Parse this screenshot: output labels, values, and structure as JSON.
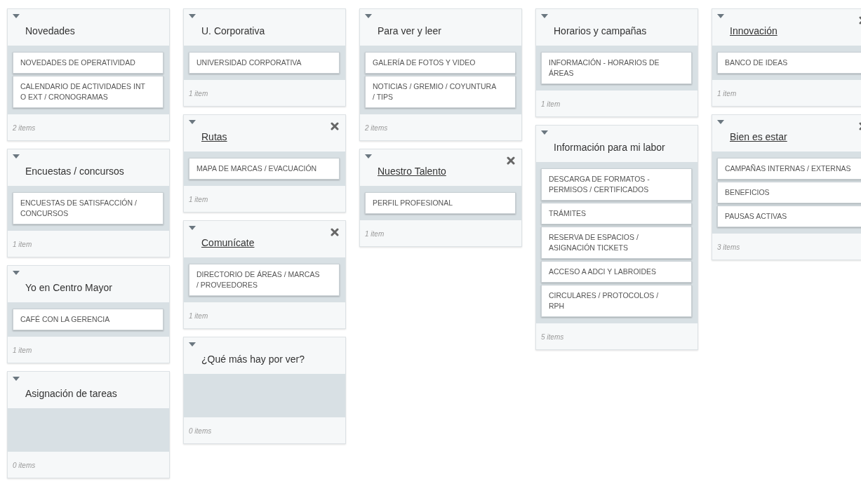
{
  "columns": [
    {
      "lists": [
        {
          "title": "Novedades",
          "linked": false,
          "removable": false,
          "cards": [
            "NOVEDADES DE OPERATIVIDAD",
            "CALENDARIO DE ACTIVIDADES INT O EXT / CRONOGRAMAS"
          ],
          "count": "2 items"
        },
        {
          "title": "Encuestas / concursos",
          "linked": false,
          "removable": false,
          "cards": [
            "ENCUESTAS DE SATISFACCIÓN / CONCURSOS"
          ],
          "count": "1 item"
        },
        {
          "title": "Yo en Centro Mayor",
          "linked": false,
          "removable": false,
          "cards": [
            "CAFÉ CON LA GERENCIA"
          ],
          "count": "1 item"
        },
        {
          "title": "Asignación de tareas",
          "linked": false,
          "removable": false,
          "count": "0 items"
        }
      ]
    },
    {
      "lists": [
        {
          "title": "U. Corporativa",
          "linked": false,
          "removable": false,
          "cards": [
            "UNIVERSIDAD CORPORATIVA"
          ],
          "count": "1 item"
        },
        {
          "title": "Rutas",
          "linked": true,
          "removable": true,
          "cards": [
            "MAPA DE MARCAS / EVACUACIÓN"
          ],
          "count": "1 item"
        },
        {
          "title": "Comunícate",
          "linked": true,
          "removable": true,
          "cards": [
            "DIRECTORIO DE ÁREAS / MARCAS / PROVEEDORES"
          ],
          "count": "1 item"
        },
        {
          "title": "¿Qué más hay por ver?",
          "linked": false,
          "removable": false,
          "count": "0 items"
        }
      ]
    },
    {
      "lists": [
        {
          "title": "Para ver y leer",
          "linked": false,
          "removable": false,
          "cards": [
            "GALERÍA DE FOTOS Y VIDEO",
            "NOTICIAS / GREMIO / COYUNTURA / TIPS"
          ],
          "count": "2 items"
        },
        {
          "title": "Nuestro Talento",
          "linked": true,
          "removable": true,
          "cards": [
            "PERFIL PROFESIONAL"
          ],
          "count": "1 item"
        }
      ]
    },
    {
      "lists": [
        {
          "title": "Horarios y campañas",
          "linked": false,
          "removable": false,
          "cards": [
            "INFORMACIÓN - HORARIOS DE ÁREAS"
          ],
          "count": "1 item"
        },
        {
          "title": "Información para mi labor",
          "linked": false,
          "removable": false,
          "cards": [
            "DESCARGA DE FORMATOS - PERMISOS / CERTIFICADOS",
            "TRÁMITES",
            "RESERVA DE ESPACIOS / ASIGNACIÓN TICKETS",
            "ACCESO A ADCI Y LABROIDES",
            "CIRCULARES / PROTOCOLOS / RPH"
          ],
          "count": "5 items"
        }
      ]
    },
    {
      "lists": [
        {
          "title": "Innovación",
          "linked": true,
          "removable": true,
          "cards": [
            "BANCO DE IDEAS"
          ],
          "count": "1 item"
        },
        {
          "title": "Bien es estar",
          "linked": true,
          "removable": true,
          "cards": [
            "CAMPAÑAS INTERNAS / EXTERNAS",
            "BENEFICIOS",
            "PAUSAS ACTIVAS"
          ],
          "count": "3 items"
        }
      ]
    }
  ]
}
